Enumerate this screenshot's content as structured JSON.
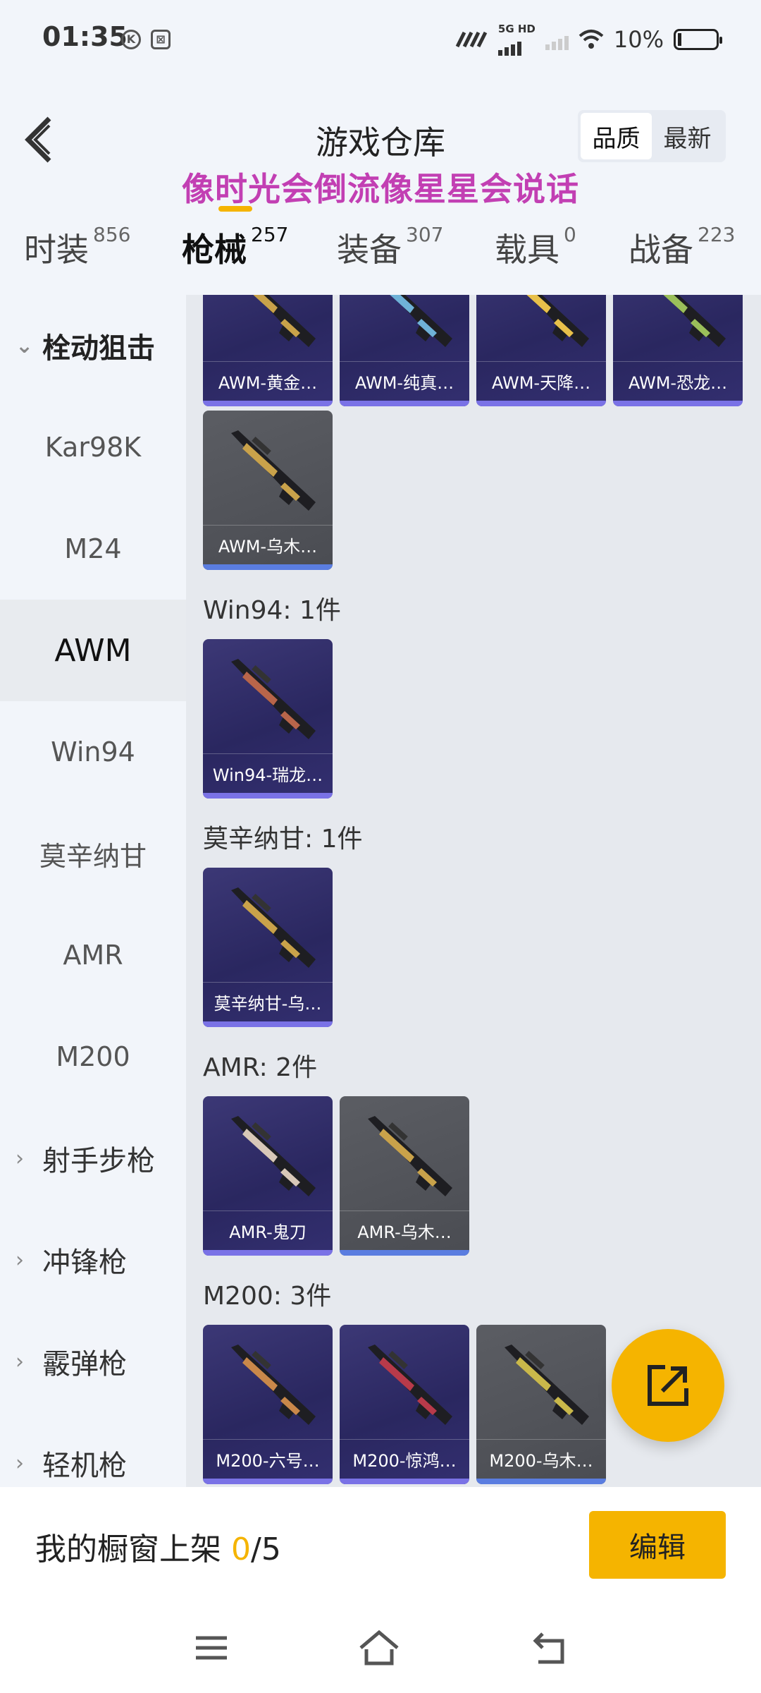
{
  "status_bar": {
    "time": "01:35",
    "network": "5G HD",
    "battery": "10%",
    "notif_icons": [
      "K",
      "⊠"
    ]
  },
  "header": {
    "title": "游戏仓库",
    "marquee": "像时光会倒流像星星会说话",
    "sort_options": [
      "品质",
      "最新"
    ],
    "sort_active": "品质"
  },
  "tabs": [
    {
      "label": "时装",
      "count": "856"
    },
    {
      "label": "枪械",
      "count": "257"
    },
    {
      "label": "装备",
      "count": "307"
    },
    {
      "label": "载具",
      "count": "0"
    },
    {
      "label": "战备",
      "count": "223"
    }
  ],
  "sidebar": {
    "items": [
      {
        "label": "栓动狙击",
        "type": "group-open"
      },
      {
        "label": "Kar98K",
        "type": "item"
      },
      {
        "label": "M24",
        "type": "item"
      },
      {
        "label": "AWM",
        "type": "item-active"
      },
      {
        "label": "Win94",
        "type": "item"
      },
      {
        "label": "莫辛纳甘",
        "type": "item"
      },
      {
        "label": "AMR",
        "type": "item"
      },
      {
        "label": "M200",
        "type": "item"
      },
      {
        "label": "射手步枪",
        "type": "group"
      },
      {
        "label": "冲锋枪",
        "type": "group"
      },
      {
        "label": "霰弹枪",
        "type": "group"
      },
      {
        "label": "轻机枪",
        "type": "group"
      }
    ]
  },
  "content": {
    "sections": [
      {
        "label": "",
        "items": [
          {
            "name": "AWM-黄金…",
            "rarity": "purple",
            "accent": "#c9a24a"
          },
          {
            "name": "AWM-纯真…",
            "rarity": "purple",
            "accent": "#6fb2d8"
          },
          {
            "name": "AWM-天降…",
            "rarity": "purple",
            "accent": "#e8c04a"
          },
          {
            "name": "AWM-恐龙…",
            "rarity": "purple",
            "accent": "#9bbf5a"
          },
          {
            "name": "AWM-乌木…",
            "rarity": "gray",
            "accent": "#c9a24a"
          }
        ]
      },
      {
        "label": "Win94: 1件",
        "items": [
          {
            "name": "Win94-瑞龙…",
            "rarity": "purple",
            "accent": "#b8654a"
          }
        ]
      },
      {
        "label": "莫辛纳甘: 1件",
        "items": [
          {
            "name": "莫辛纳甘-乌…",
            "rarity": "purple",
            "accent": "#c9a24a"
          }
        ]
      },
      {
        "label": "AMR: 2件",
        "items": [
          {
            "name": "AMR-鬼刀",
            "rarity": "purple",
            "accent": "#d8c8b8"
          },
          {
            "name": "AMR-乌木…",
            "rarity": "gray",
            "accent": "#c9a24a"
          }
        ]
      },
      {
        "label": "M200: 3件",
        "items": [
          {
            "name": "M200-六号…",
            "rarity": "purple",
            "accent": "#c9884a"
          },
          {
            "name": "M200-惊鸿…",
            "rarity": "purple",
            "accent": "#b83a4a"
          },
          {
            "name": "M200-乌木…",
            "rarity": "gray",
            "accent": "#c9b84a"
          }
        ]
      }
    ]
  },
  "shelf": {
    "prefix": "我的橱窗上架 ",
    "count": "0",
    "total": "/5",
    "edit_label": "编辑"
  },
  "colors": {
    "accent": "#f5b400",
    "marquee": "#c23fb3",
    "purple_card": "#2a2760",
    "gray_card": "#4a4c52"
  }
}
